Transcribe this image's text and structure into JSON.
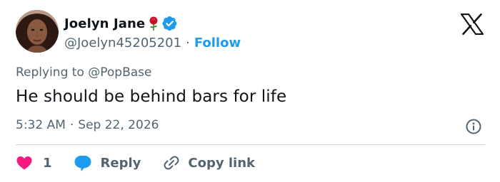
{
  "author": {
    "display_name": "Joelyn Jane",
    "handle": "@Joelyn45205201",
    "follow_label": "Follow",
    "separator": "·",
    "name_emoji": "rose-icon",
    "verified_icon": "verified-badge-icon"
  },
  "brand": {
    "logo": "x-logo-icon"
  },
  "reply_context": {
    "prefix": "Replying to",
    "mention": "@PopBase"
  },
  "tweet": {
    "text": "He should be behind bars for life",
    "time": "5:32 AM",
    "separator": "·",
    "date": "Sep 22, 2026"
  },
  "actions": {
    "like_count": "1",
    "reply_label": "Reply",
    "copy_label": "Copy link"
  },
  "colors": {
    "accent": "#1d9bf0",
    "like": "#f91880",
    "text": "#0f1419",
    "muted": "#536471",
    "divider": "#cfd9de"
  }
}
